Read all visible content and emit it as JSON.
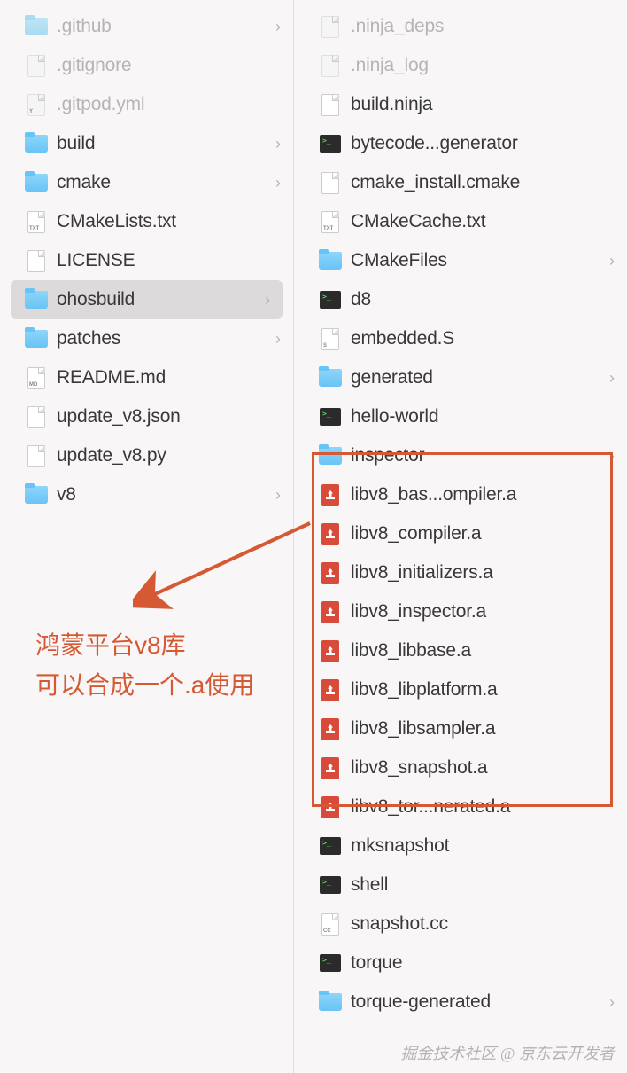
{
  "leftColumn": [
    {
      "label": ".github",
      "icon": "folder",
      "hasChevron": true,
      "dimmed": true
    },
    {
      "label": ".gitignore",
      "icon": "file",
      "dimmed": true
    },
    {
      "label": ".gitpod.yml",
      "icon": "file",
      "dimmed": true,
      "tag": "Y"
    },
    {
      "label": "build",
      "icon": "folder",
      "hasChevron": true
    },
    {
      "label": "cmake",
      "icon": "folder",
      "hasChevron": true
    },
    {
      "label": "CMakeLists.txt",
      "icon": "file",
      "tag": "TXT"
    },
    {
      "label": "LICENSE",
      "icon": "file"
    },
    {
      "label": "ohosbuild",
      "icon": "folder",
      "hasChevron": true,
      "selected": true
    },
    {
      "label": "patches",
      "icon": "folder",
      "hasChevron": true
    },
    {
      "label": "README.md",
      "icon": "file",
      "tag": "MD"
    },
    {
      "label": "update_v8.json",
      "icon": "file"
    },
    {
      "label": "update_v8.py",
      "icon": "file"
    },
    {
      "label": "v8",
      "icon": "folder",
      "hasChevron": true
    }
  ],
  "rightColumn": [
    {
      "label": ".ninja_deps",
      "icon": "file",
      "dimmed": true
    },
    {
      "label": ".ninja_log",
      "icon": "file",
      "dimmed": true
    },
    {
      "label": "build.ninja",
      "icon": "file"
    },
    {
      "label": "bytecode...generator",
      "icon": "exec"
    },
    {
      "label": "cmake_install.cmake",
      "icon": "file"
    },
    {
      "label": "CMakeCache.txt",
      "icon": "file",
      "tag": "TXT"
    },
    {
      "label": "CMakeFiles",
      "icon": "folder",
      "hasChevron": true
    },
    {
      "label": "d8",
      "icon": "exec"
    },
    {
      "label": "embedded.S",
      "icon": "file",
      "tag": "S"
    },
    {
      "label": "generated",
      "icon": "folder",
      "hasChevron": true
    },
    {
      "label": "hello-world",
      "icon": "exec"
    },
    {
      "label": "inspector",
      "icon": "folder",
      "hasChevron": true
    },
    {
      "label": "libv8_bas...ompiler.a",
      "icon": "archive"
    },
    {
      "label": "libv8_compiler.a",
      "icon": "archive"
    },
    {
      "label": "libv8_initializers.a",
      "icon": "archive"
    },
    {
      "label": "libv8_inspector.a",
      "icon": "archive"
    },
    {
      "label": "libv8_libbase.a",
      "icon": "archive"
    },
    {
      "label": "libv8_libplatform.a",
      "icon": "archive"
    },
    {
      "label": "libv8_libsampler.a",
      "icon": "archive"
    },
    {
      "label": "libv8_snapshot.a",
      "icon": "archive"
    },
    {
      "label": "libv8_tor...nerated.a",
      "icon": "archive"
    },
    {
      "label": "mksnapshot",
      "icon": "exec"
    },
    {
      "label": "shell",
      "icon": "exec"
    },
    {
      "label": "snapshot.cc",
      "icon": "file",
      "tag": "CC"
    },
    {
      "label": "torque",
      "icon": "exec"
    },
    {
      "label": "torque-generated",
      "icon": "folder",
      "hasChevron": true
    }
  ],
  "annotation": {
    "line1": "鸿蒙平台v8库",
    "line2": "可以合成一个.a使用"
  },
  "watermark": "掘金技术社区 @ 京东云开发者",
  "colors": {
    "highlight": "#d55a33"
  }
}
